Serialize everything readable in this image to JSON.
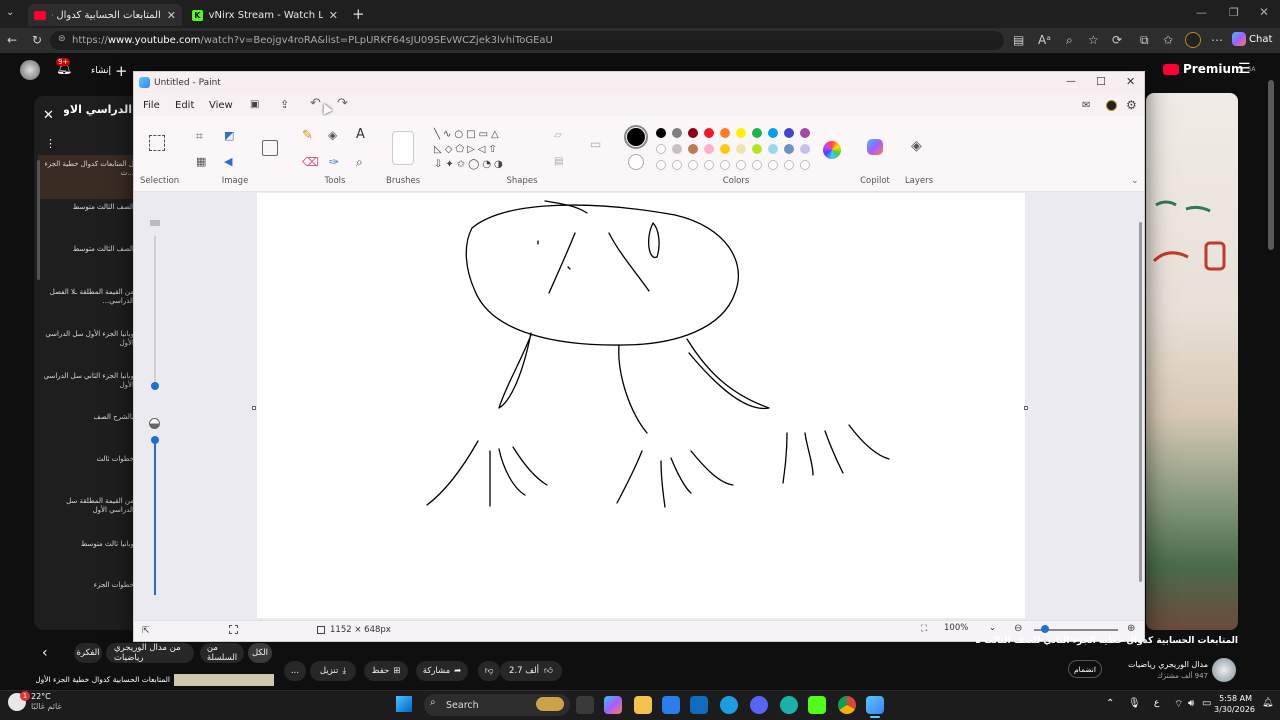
{
  "browser": {
    "tabs": [
      {
        "title": "المتابعات الحسابية كدوال خطية الجز",
        "active": true
      },
      {
        "title": "vNirx Stream - Watch Live on Kick",
        "active": false
      }
    ],
    "new_tab": "+",
    "url_prefix": "https://",
    "url_domain": "www.youtube.com",
    "url_path": "/watch?v=Beojgv4roRA&list=PLpURKF64sJU09SEvWCZjek3lvhiToGEaU",
    "chat_label": "Chat"
  },
  "youtube": {
    "create_label": "إنشاء",
    "notif_count": "9+",
    "premium_label": "Premium",
    "premium_region": "SA",
    "playlist_title": "الدراسي الاول",
    "playlist_items": [
      "ل المتابعات كدوال خطية الجزء ...ث",
      "الصف الثالث متوسط",
      "الصف الثالث متوسط",
      "من القيمة المطلقة ـلا الفصل الدراسي...",
      "وبانيا الجزء الأول سل الدراسي الأول",
      "وبانيا الجزء الثاني سل الدراسي الأول",
      "بالشرح الصف",
      "خطوات ثالث",
      "من القيمة المطلقة سل الدراسي الأول",
      "وبانيا ثالث متوسط",
      "خطوات الجزء"
    ],
    "video_title": "المتابعات الحسابية كدوال خطية الجزء الثاني للصف الثالث متوسط",
    "channel_name": "مدال الوريجري رياضيات",
    "subscribers": "947 ألف مشترك",
    "join_label": "انضمام",
    "likes": "2.7 ألف",
    "share_label": "مشاركة",
    "save_label": "حفظ",
    "download_label": "تنزيل",
    "more_label": "...",
    "chips": [
      "الكل",
      "من السلسلة",
      "من مدال الوريجري رياضيات",
      "الفكرة"
    ],
    "next_label": "المتابعات الحسابية كدوال خطية الجزء الأول"
  },
  "paint": {
    "title": "Untitled - Paint",
    "menu": [
      "File",
      "Edit",
      "View"
    ],
    "groups": [
      "Selection",
      "Image",
      "Tools",
      "Brushes",
      "Shapes",
      "Colors",
      "Copilot",
      "Layers"
    ],
    "status_size": "1152 × 648px",
    "zoom": "100%",
    "colors_row1": [
      "#000000",
      "#7f7f7f",
      "#880015",
      "#ed1c24",
      "#ff7f27",
      "#fff200",
      "#22b14c",
      "#00a2e8",
      "#3f48cc",
      "#a349a4"
    ],
    "colors_row2": [
      "#ffffff",
      "#c3c3c3",
      "#b97a57",
      "#ffaec9",
      "#ffc90e",
      "#efe4b0",
      "#b5e61d",
      "#99d9ea",
      "#7092be",
      "#c8bfe7"
    ],
    "primary_color": "#000000",
    "secondary_color": "#ffffff"
  },
  "taskbar": {
    "weather_temp": "22°C",
    "weather_desc": "غائم غالبًا",
    "search_label": "Search",
    "time": "5:58 AM",
    "date": "3/30/2026",
    "badge": "1"
  }
}
